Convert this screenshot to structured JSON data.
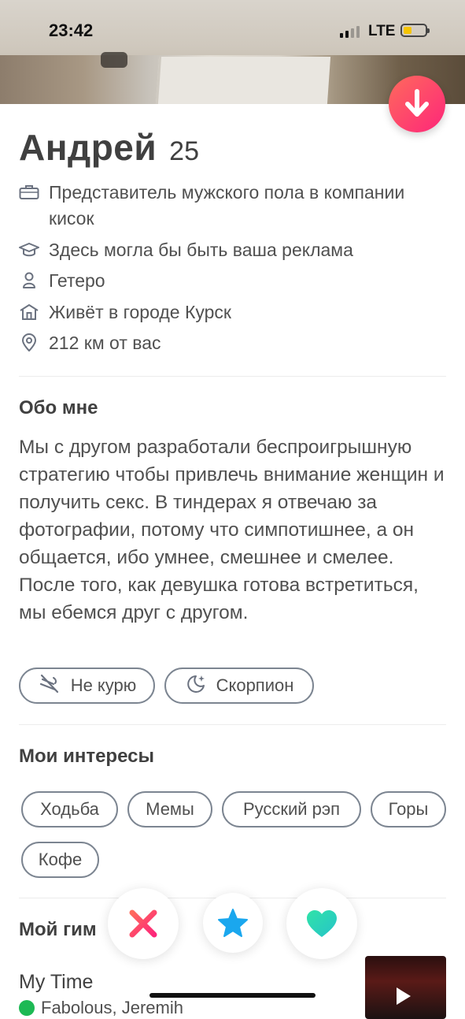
{
  "status_bar": {
    "time": "23:42",
    "network": "LTE"
  },
  "profile": {
    "name": "Андрей",
    "age": "25",
    "job": "Представитель мужского пола в компании кисок",
    "school": "Здесь могла бы быть ваша реклама",
    "orientation": "Гетеро",
    "city": "Живёт в городе Курск",
    "distance": "212 км от вас"
  },
  "about": {
    "title": "Обо мне",
    "text": "Мы с другом разработали беспроигрышную стратегию чтобы привлечь внимание женщин и получить секс. В тиндерах я отвечаю за фотографии, потому что симпотишнее, а он общается, ибо умнее, смешнее и смелее. После того, как девушка готова встретиться, мы ебемся друг с другом.",
    "tags": [
      {
        "label": "Не курю",
        "icon": "no-smoking-icon"
      },
      {
        "label": "Скорпион",
        "icon": "zodiac-moon-icon"
      }
    ]
  },
  "interests": {
    "title": "Мои интересы",
    "items": [
      "Ходьба",
      "Мемы",
      "Русский рэп",
      "Горы",
      "Кофе"
    ]
  },
  "anthem": {
    "title": "Мой гим",
    "song": "My Time",
    "artist": "Fabolous, Jeremih"
  },
  "colors": {
    "accent_gradient_start": "#ff6a5c",
    "accent_gradient_end": "#fd267a",
    "nope": "#fd3c5f",
    "superlike": "#1aa7ee",
    "like": "#2fdcb6",
    "battery": "#f5c400"
  }
}
